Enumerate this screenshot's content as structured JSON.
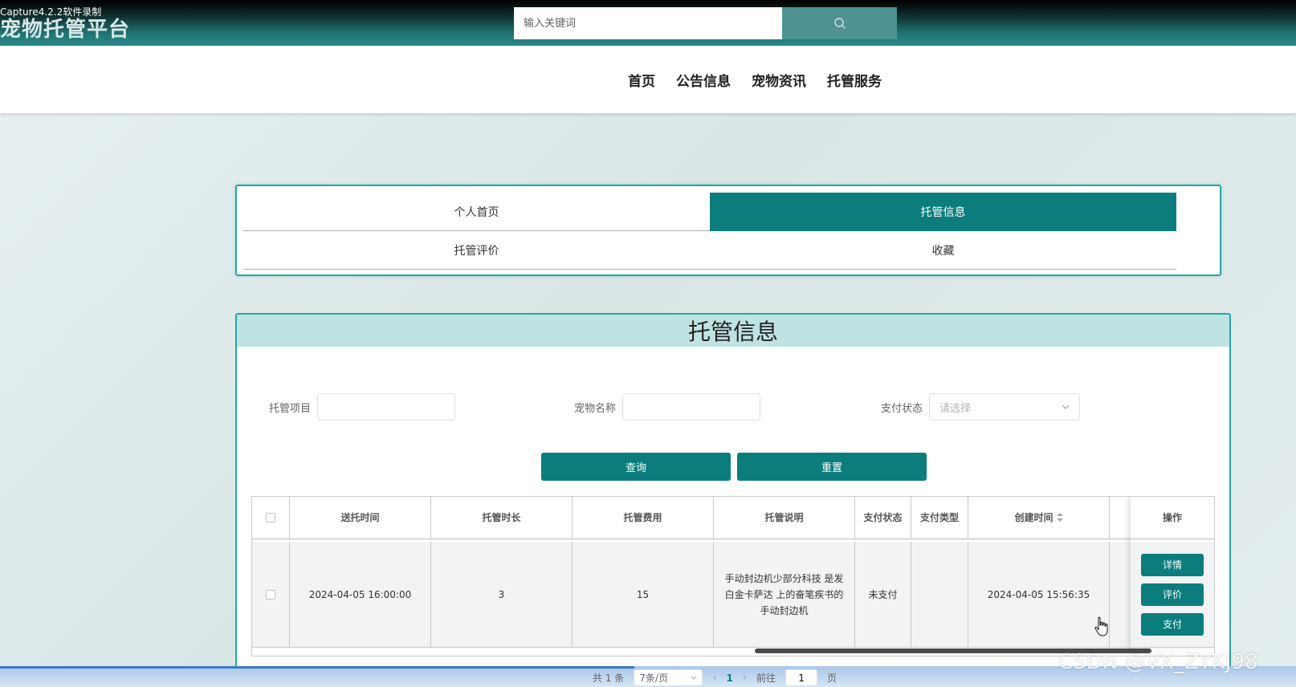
{
  "header": {
    "recorder_label": "Capture4.2.2软件录制",
    "brand": "宠物托管平台",
    "search_placeholder": "输入关键词",
    "search_icon": "search-icon"
  },
  "nav": {
    "items": [
      "首页",
      "公告信息",
      "宠物资讯",
      "托管服务"
    ]
  },
  "tabs": [
    {
      "label": "个人首页",
      "active": false
    },
    {
      "label": "托管信息",
      "active": true
    },
    {
      "label": "托管评价",
      "active": false
    },
    {
      "label": "收藏",
      "active": false
    }
  ],
  "panel": {
    "title": "托管信息"
  },
  "filters": {
    "project_label": "托管项目",
    "project_value": "",
    "pet_label": "宠物名称",
    "pet_value": "",
    "pay_label": "支付状态",
    "pay_placeholder": "请选择"
  },
  "buttons": {
    "query": "查询",
    "reset": "重置"
  },
  "table": {
    "headers": [
      "送托时间",
      "托管时长",
      "托管费用",
      "托管说明",
      "支付状态",
      "支付类型",
      "创建时间",
      "操作"
    ],
    "rows": [
      {
        "send_time": "2024-04-05 16:00:00",
        "duration": "3",
        "fee": "15",
        "description": "手动封边机少部分科技 是发白金卡萨达 上的奋笔疾书的手动封边机",
        "pay_status": "未支付",
        "pay_type": "",
        "created": "2024-04-05 15:56:35",
        "actions": [
          "详情",
          "评价",
          "支付"
        ]
      }
    ]
  },
  "pagination": {
    "total": "共 1 条",
    "page_size": "7条/页",
    "current_page": "1",
    "goto_label": "前往",
    "goto_value": "1",
    "page_suffix": "页"
  },
  "watermark": "CSDN @VX_ZYKJ98",
  "colors": {
    "accent": "#0b7d7d",
    "panel_border": "#2aa5a5",
    "title_bar": "#bfe3e3"
  }
}
